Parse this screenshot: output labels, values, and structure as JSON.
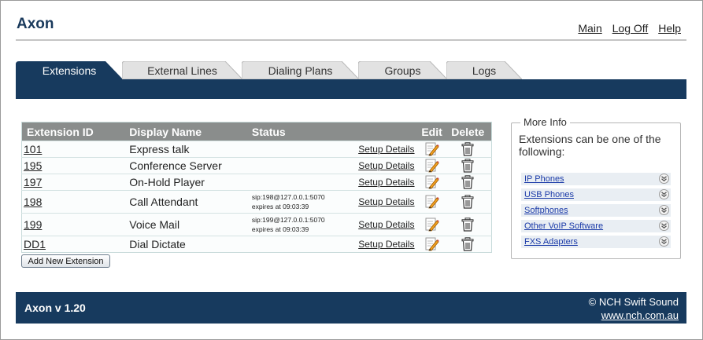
{
  "app": {
    "title": "Axon"
  },
  "top_links": [
    "Main",
    "Log Off",
    "Help"
  ],
  "tabs": [
    {
      "label": "Extensions",
      "active": true
    },
    {
      "label": "External Lines",
      "active": false
    },
    {
      "label": "Dialing Plans",
      "active": false
    },
    {
      "label": "Groups",
      "active": false
    },
    {
      "label": "Logs",
      "active": false
    }
  ],
  "table": {
    "headers": [
      "Extension ID",
      "Display Name",
      "Status",
      "Edit",
      "Delete"
    ],
    "rows": [
      {
        "id": "101",
        "name": "Express talk",
        "status_line1": "",
        "status_line2": "",
        "setup": "Setup Details"
      },
      {
        "id": "195",
        "name": "Conference Server",
        "status_line1": "",
        "status_line2": "",
        "setup": "Setup Details"
      },
      {
        "id": "197",
        "name": "On-Hold Player",
        "status_line1": "",
        "status_line2": "",
        "setup": "Setup Details"
      },
      {
        "id": "198",
        "name": "Call Attendant",
        "status_line1": "sip:198@127.0.0.1:5070",
        "status_line2": "expires at 09:03:39",
        "setup": "Setup Details"
      },
      {
        "id": "199",
        "name": "Voice Mail",
        "status_line1": "sip:199@127.0.0.1:5070",
        "status_line2": "expires at 09:03:39",
        "setup": "Setup Details"
      },
      {
        "id": "DD1",
        "name": "Dial Dictate",
        "status_line1": "",
        "status_line2": "",
        "setup": "Setup Details"
      }
    ]
  },
  "add_button": "Add New Extension",
  "more_info": {
    "title": "More Info",
    "description": "Extensions can be one of the following:",
    "items": [
      "IP Phones",
      "USB Phones",
      "Softphones",
      "Other VoIP Software",
      "FXS Adapters"
    ]
  },
  "footer": {
    "version": "Axon v 1.20",
    "copyright": "© NCH Swift Sound",
    "website": "www.nch.com.au"
  },
  "colors": {
    "brand_navy": "#173a5e",
    "table_header": "#8a8d8c",
    "link_blue": "#1a3aa8"
  },
  "icons": {
    "edit": "pencil-icon",
    "delete": "trash-icon",
    "expand": "chevron-down-icon"
  }
}
